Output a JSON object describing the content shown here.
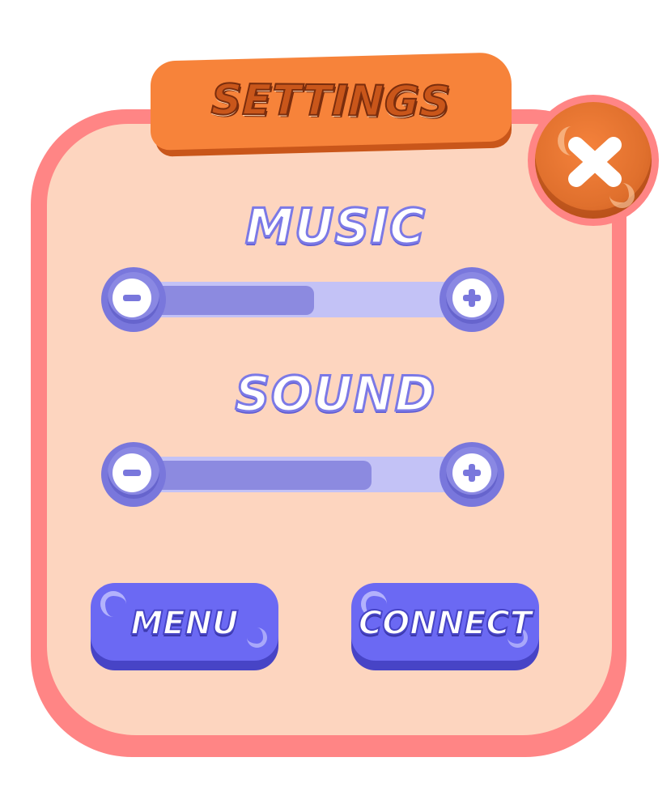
{
  "dialog": {
    "title": "SETTINGS"
  },
  "music": {
    "label": "MUSIC",
    "level_percent": 53
  },
  "sound": {
    "label": "SOUND",
    "level_percent": 70
  },
  "buttons": {
    "menu_label": "MENU",
    "connect_label": "CONNECT"
  },
  "icons": {
    "close": "close-icon",
    "decrease": "minus-icon",
    "increase": "plus-icon"
  },
  "colors": {
    "panel_border": "#ff8585",
    "panel_fill": "#fdd5bf",
    "title_ribbon": "#f7833a",
    "close_button": "#e0702d",
    "slider_track": "#c3c2f6",
    "slider_fill": "#8c8ae0",
    "slider_knob": "#7977dc",
    "button": "#6b69f3"
  }
}
